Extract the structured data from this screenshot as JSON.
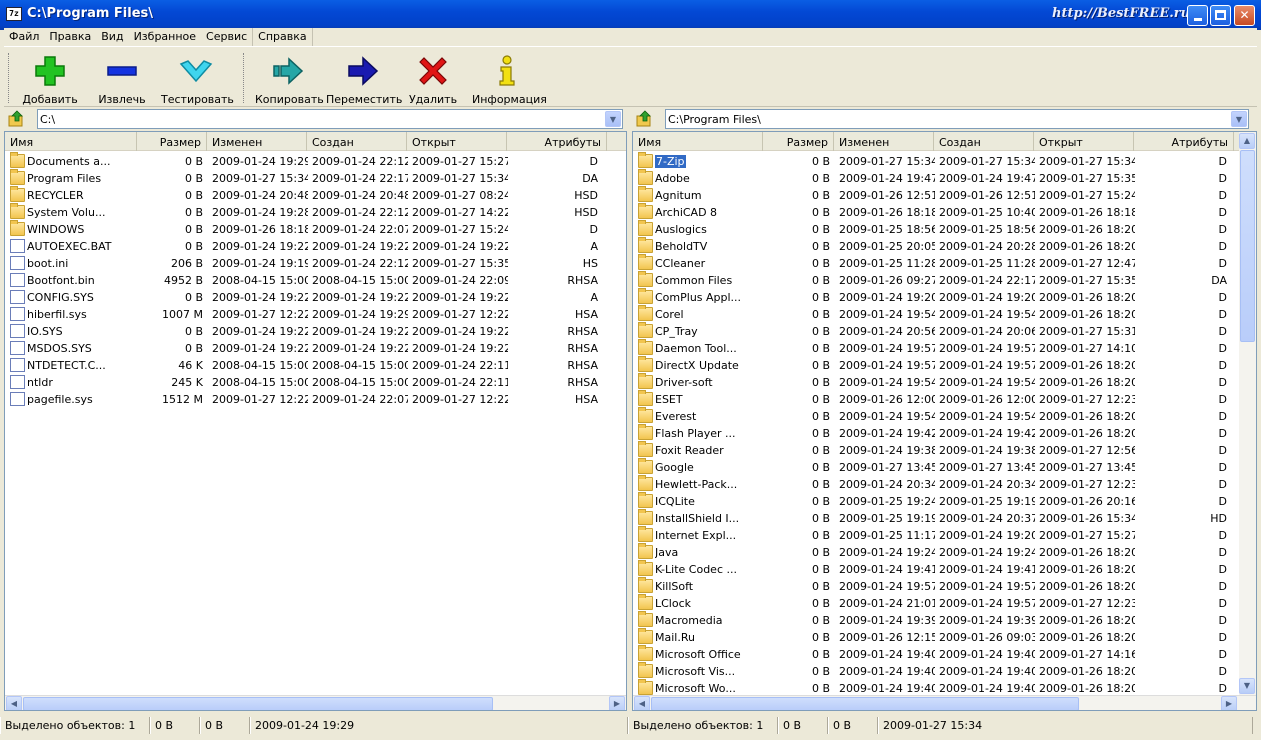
{
  "window": {
    "title": "C:\\Program Files\\",
    "watermark": "http://BestFREE.ru",
    "app_icon": "7z"
  },
  "menu": [
    "Файл",
    "Правка",
    "Вид",
    "Избранное",
    "Сервис",
    "Справка"
  ],
  "toolbar": [
    {
      "label": "Добавить",
      "icon": "plus-icon"
    },
    {
      "label": "Извлечь",
      "icon": "minus-icon"
    },
    {
      "label": "Тестировать",
      "icon": "check-icon"
    },
    {
      "label": "Копировать",
      "icon": "copy-arrow-icon"
    },
    {
      "label": "Переместить",
      "icon": "move-arrow-icon"
    },
    {
      "label": "Удалить",
      "icon": "delete-x-icon"
    },
    {
      "label": "Информация",
      "icon": "info-icon"
    }
  ],
  "columns": [
    "Имя",
    "Размер",
    "Изменен",
    "Создан",
    "Открыт",
    "Атрибуты"
  ],
  "left": {
    "path": "C:\\",
    "rows": [
      [
        "Documents a...",
        "0 B",
        "2009-01-24 19:29",
        "2009-01-24 22:12",
        "2009-01-27 15:27",
        "D",
        "folder"
      ],
      [
        "Program Files",
        "0 B",
        "2009-01-27 15:34",
        "2009-01-24 22:17",
        "2009-01-27 15:34",
        "DA",
        "folder"
      ],
      [
        "RECYCLER",
        "0 B",
        "2009-01-24 20:48",
        "2009-01-24 20:48",
        "2009-01-27 08:24",
        "HSD",
        "folder"
      ],
      [
        "System Volu...",
        "0 B",
        "2009-01-24 19:28",
        "2009-01-24 22:12",
        "2009-01-27 14:22",
        "HSD",
        "folder"
      ],
      [
        "WINDOWS",
        "0 B",
        "2009-01-26 18:18",
        "2009-01-24 22:07",
        "2009-01-27 15:24",
        "D",
        "folder"
      ],
      [
        "AUTOEXEC.BAT",
        "0 B",
        "2009-01-24 19:22",
        "2009-01-24 19:22",
        "2009-01-24 19:22",
        "A",
        "file"
      ],
      [
        "boot.ini",
        "206 B",
        "2009-01-24 19:19",
        "2009-01-24 22:12",
        "2009-01-27 15:35",
        "HS",
        "file"
      ],
      [
        "Bootfont.bin",
        "4952 B",
        "2008-04-15 15:00",
        "2008-04-15 15:00",
        "2009-01-24 22:09",
        "RHSA",
        "file"
      ],
      [
        "CONFIG.SYS",
        "0 B",
        "2009-01-24 19:22",
        "2009-01-24 19:22",
        "2009-01-24 19:22",
        "A",
        "file"
      ],
      [
        "hiberfil.sys",
        "1007 M",
        "2009-01-27 12:22",
        "2009-01-24 19:29",
        "2009-01-27 12:22",
        "HSA",
        "file"
      ],
      [
        "IO.SYS",
        "0 B",
        "2009-01-24 19:22",
        "2009-01-24 19:22",
        "2009-01-24 19:22",
        "RHSA",
        "file"
      ],
      [
        "MSDOS.SYS",
        "0 B",
        "2009-01-24 19:22",
        "2009-01-24 19:22",
        "2009-01-24 19:22",
        "RHSA",
        "file"
      ],
      [
        "NTDETECT.C...",
        "46 K",
        "2008-04-15 15:00",
        "2008-04-15 15:00",
        "2009-01-24 22:11",
        "RHSA",
        "file"
      ],
      [
        "ntldr",
        "245 K",
        "2008-04-15 15:00",
        "2008-04-15 15:00",
        "2009-01-24 22:11",
        "RHSA",
        "file"
      ],
      [
        "pagefile.sys",
        "1512 M",
        "2009-01-27 12:22",
        "2009-01-24 22:07",
        "2009-01-27 12:22",
        "HSA",
        "file"
      ]
    ],
    "status": [
      "Выделено объектов: 1",
      "0 B",
      "0 B",
      "2009-01-24 19:29"
    ]
  },
  "right": {
    "path": "C:\\Program Files\\",
    "rows": [
      [
        "7-Zip",
        "0 B",
        "2009-01-27 15:34",
        "2009-01-27 15:34",
        "2009-01-27 15:34",
        "D",
        "folder"
      ],
      [
        "Adobe",
        "0 B",
        "2009-01-24 19:47",
        "2009-01-24 19:47",
        "2009-01-27 15:35",
        "D",
        "folder"
      ],
      [
        "Agnitum",
        "0 B",
        "2009-01-26 12:51",
        "2009-01-26 12:51",
        "2009-01-27 15:24",
        "D",
        "folder"
      ],
      [
        "ArchiCAD 8",
        "0 B",
        "2009-01-26 18:18",
        "2009-01-25 10:40",
        "2009-01-26 18:18",
        "D",
        "folder"
      ],
      [
        "Auslogics",
        "0 B",
        "2009-01-25 18:56",
        "2009-01-25 18:56",
        "2009-01-26 18:20",
        "D",
        "folder"
      ],
      [
        "BeholdTV",
        "0 B",
        "2009-01-25 20:05",
        "2009-01-24 20:28",
        "2009-01-26 18:20",
        "D",
        "folder"
      ],
      [
        "CCleaner",
        "0 B",
        "2009-01-25 11:28",
        "2009-01-25 11:28",
        "2009-01-27 12:47",
        "D",
        "folder"
      ],
      [
        "Common Files",
        "0 B",
        "2009-01-26 09:27",
        "2009-01-24 22:17",
        "2009-01-27 15:35",
        "DA",
        "folder"
      ],
      [
        "ComPlus Appl...",
        "0 B",
        "2009-01-24 19:20",
        "2009-01-24 19:20",
        "2009-01-26 18:20",
        "D",
        "folder"
      ],
      [
        "Corel",
        "0 B",
        "2009-01-24 19:54",
        "2009-01-24 19:54",
        "2009-01-26 18:20",
        "D",
        "folder"
      ],
      [
        "CP_Tray",
        "0 B",
        "2009-01-24 20:56",
        "2009-01-24 20:06",
        "2009-01-27 15:31",
        "D",
        "folder"
      ],
      [
        "Daemon Tool...",
        "0 B",
        "2009-01-24 19:57",
        "2009-01-24 19:57",
        "2009-01-27 14:10",
        "D",
        "folder"
      ],
      [
        "DirectX Update",
        "0 B",
        "2009-01-24 19:57",
        "2009-01-24 19:57",
        "2009-01-26 18:20",
        "D",
        "folder"
      ],
      [
        "Driver-soft",
        "0 B",
        "2009-01-24 19:54",
        "2009-01-24 19:54",
        "2009-01-26 18:20",
        "D",
        "folder"
      ],
      [
        "ESET",
        "0 B",
        "2009-01-26 12:00",
        "2009-01-26 12:00",
        "2009-01-27 12:23",
        "D",
        "folder"
      ],
      [
        "Everest",
        "0 B",
        "2009-01-24 19:54",
        "2009-01-24 19:54",
        "2009-01-26 18:20",
        "D",
        "folder"
      ],
      [
        "Flash Player ...",
        "0 B",
        "2009-01-24 19:42",
        "2009-01-24 19:42",
        "2009-01-26 18:20",
        "D",
        "folder"
      ],
      [
        "Foxit Reader",
        "0 B",
        "2009-01-24 19:38",
        "2009-01-24 19:38",
        "2009-01-27 12:56",
        "D",
        "folder"
      ],
      [
        "Google",
        "0 B",
        "2009-01-27 13:45",
        "2009-01-27 13:45",
        "2009-01-27 13:45",
        "D",
        "folder"
      ],
      [
        "Hewlett-Pack...",
        "0 B",
        "2009-01-24 20:34",
        "2009-01-24 20:34",
        "2009-01-27 12:23",
        "D",
        "folder"
      ],
      [
        "ICQLite",
        "0 B",
        "2009-01-25 19:24",
        "2009-01-25 19:19",
        "2009-01-26 20:16",
        "D",
        "folder"
      ],
      [
        "InstallShield I...",
        "0 B",
        "2009-01-25 19:19",
        "2009-01-24 20:37",
        "2009-01-26 15:34",
        "HD",
        "folder"
      ],
      [
        "Internet Expl...",
        "0 B",
        "2009-01-25 11:17",
        "2009-01-24 19:20",
        "2009-01-27 15:27",
        "D",
        "folder"
      ],
      [
        "Java",
        "0 B",
        "2009-01-24 19:24",
        "2009-01-24 19:24",
        "2009-01-26 18:20",
        "D",
        "folder"
      ],
      [
        "K-Lite Codec ...",
        "0 B",
        "2009-01-24 19:41",
        "2009-01-24 19:41",
        "2009-01-26 18:20",
        "D",
        "folder"
      ],
      [
        "KillSoft",
        "0 B",
        "2009-01-24 19:57",
        "2009-01-24 19:57",
        "2009-01-26 18:20",
        "D",
        "folder"
      ],
      [
        "LClock",
        "0 B",
        "2009-01-24 21:01",
        "2009-01-24 19:57",
        "2009-01-27 12:23",
        "D",
        "folder"
      ],
      [
        "Macromedia",
        "0 B",
        "2009-01-24 19:39",
        "2009-01-24 19:39",
        "2009-01-26 18:20",
        "D",
        "folder"
      ],
      [
        "Mail.Ru",
        "0 B",
        "2009-01-26 12:15",
        "2009-01-26 09:03",
        "2009-01-26 18:20",
        "D",
        "folder"
      ],
      [
        "Microsoft Office",
        "0 B",
        "2009-01-24 19:40",
        "2009-01-24 19:40",
        "2009-01-27 14:16",
        "D",
        "folder"
      ],
      [
        "Microsoft Vis...",
        "0 B",
        "2009-01-24 19:40",
        "2009-01-24 19:40",
        "2009-01-26 18:20",
        "D",
        "folder"
      ],
      [
        "Microsoft Wo...",
        "0 B",
        "2009-01-24 19:40",
        "2009-01-24 19:40",
        "2009-01-26 18:20",
        "D",
        "folder"
      ]
    ],
    "status": [
      "Выделено объектов: 1",
      "0 B",
      "0 B",
      "2009-01-27 15:34"
    ]
  }
}
